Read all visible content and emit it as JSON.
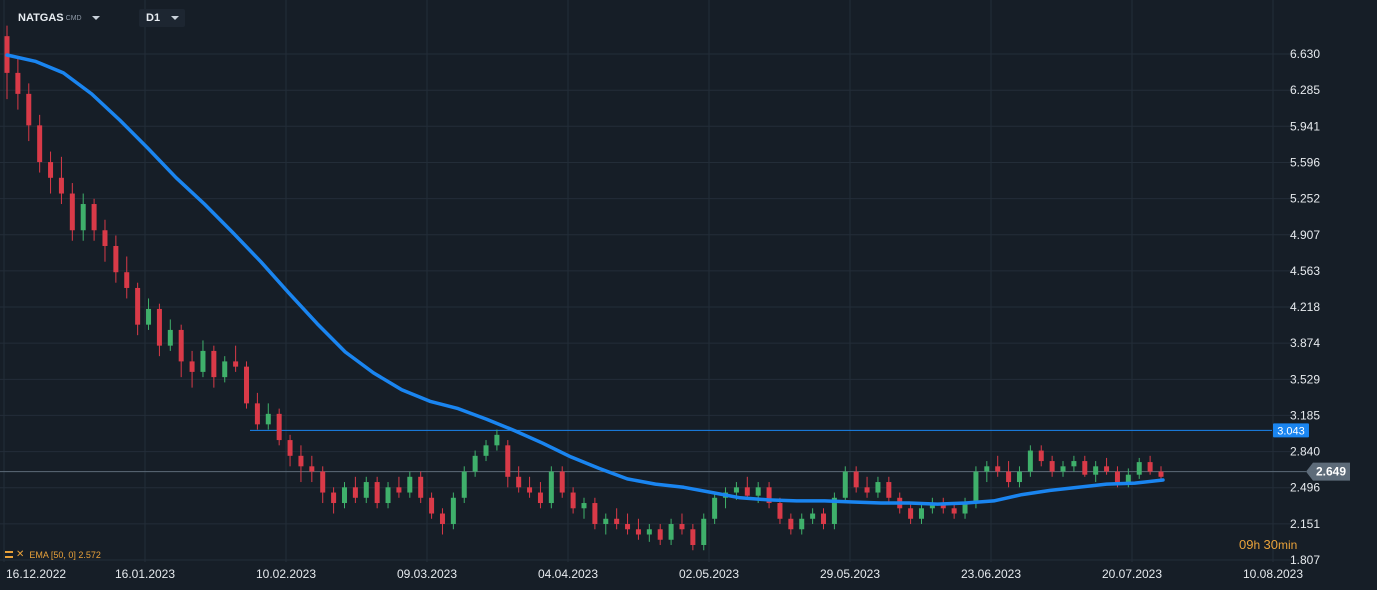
{
  "header": {
    "symbol": "NATGAS",
    "symbol_sub": "CMD",
    "timeframe": "D1"
  },
  "indicator": {
    "label": "EMA [50, 0] 2.572"
  },
  "countdown": {
    "h": "09",
    "h_unit": "h ",
    "m": "30",
    "m_unit": "min"
  },
  "colors": {
    "background": "#161e27",
    "grid": "#232d38",
    "up": "#3fb06b",
    "down": "#d93a48",
    "ema": "#1a85f0",
    "level_line": "#1a85f0",
    "price_tag": "#5d6b79",
    "axis_text": "#e6eaee"
  },
  "chart_data": {
    "type": "candlestick",
    "y_ticks": [
      "6.630",
      "6.285",
      "5.941",
      "5.596",
      "5.252",
      "4.907",
      "4.563",
      "4.218",
      "3.874",
      "3.529",
      "3.185",
      "2.840",
      "2.496",
      "2.151",
      "1.807"
    ],
    "ylim": [
      1.807,
      6.63
    ],
    "x_ticks": [
      "16.12.2022",
      "16.01.2023",
      "10.02.2023",
      "09.03.2023",
      "04.04.2023",
      "02.05.2023",
      "29.05.2023",
      "23.06.2023",
      "20.07.2023",
      "10.08.2023"
    ],
    "horizontal_level": 3.043,
    "horizontal_level_label": "3.043",
    "last_price": 2.649,
    "last_price_label": "2.649",
    "ema": {
      "name": "EMA [50, 0]",
      "value": 2.572,
      "values": [
        6.62,
        6.56,
        6.45,
        6.25,
        6.0,
        5.73,
        5.45,
        5.2,
        4.93,
        4.65,
        4.35,
        4.06,
        3.79,
        3.59,
        3.43,
        3.32,
        3.25,
        3.15,
        3.04,
        2.92,
        2.79,
        2.68,
        2.58,
        2.53,
        2.5,
        2.45,
        2.4,
        2.38,
        2.37,
        2.37,
        2.36,
        2.35,
        2.35,
        2.34,
        2.35,
        2.37,
        2.43,
        2.47,
        2.5,
        2.53,
        2.54,
        2.57
      ]
    },
    "ohlc": [
      [
        6.8,
        6.9,
        6.2,
        6.45
      ],
      [
        6.45,
        6.6,
        6.1,
        6.25
      ],
      [
        6.25,
        6.35,
        5.8,
        5.95
      ],
      [
        5.95,
        6.05,
        5.5,
        5.6
      ],
      [
        5.6,
        5.7,
        5.3,
        5.45
      ],
      [
        5.45,
        5.65,
        5.2,
        5.3
      ],
      [
        5.3,
        5.4,
        4.85,
        4.95
      ],
      [
        4.95,
        5.3,
        4.85,
        5.2
      ],
      [
        5.2,
        5.25,
        4.85,
        4.95
      ],
      [
        4.95,
        5.05,
        4.65,
        4.8
      ],
      [
        4.8,
        4.9,
        4.45,
        4.55
      ],
      [
        4.55,
        4.7,
        4.3,
        4.4
      ],
      [
        4.4,
        4.45,
        3.95,
        4.05
      ],
      [
        4.05,
        4.3,
        4.0,
        4.2
      ],
      [
        4.2,
        4.25,
        3.75,
        3.85
      ],
      [
        3.85,
        4.1,
        3.8,
        4.0
      ],
      [
        4.0,
        4.05,
        3.55,
        3.7
      ],
      [
        3.7,
        3.8,
        3.45,
        3.6
      ],
      [
        3.6,
        3.9,
        3.55,
        3.8
      ],
      [
        3.8,
        3.85,
        3.45,
        3.55
      ],
      [
        3.55,
        3.75,
        3.5,
        3.7
      ],
      [
        3.7,
        3.85,
        3.6,
        3.65
      ],
      [
        3.65,
        3.7,
        3.25,
        3.3
      ],
      [
        3.3,
        3.4,
        3.05,
        3.1
      ],
      [
        3.1,
        3.3,
        3.05,
        3.2
      ],
      [
        3.2,
        3.25,
        2.9,
        2.95
      ],
      [
        2.95,
        3.0,
        2.7,
        2.8
      ],
      [
        2.8,
        2.9,
        2.55,
        2.7
      ],
      [
        2.7,
        2.8,
        2.55,
        2.65
      ],
      [
        2.65,
        2.7,
        2.35,
        2.45
      ],
      [
        2.45,
        2.5,
        2.25,
        2.35
      ],
      [
        2.35,
        2.55,
        2.3,
        2.5
      ],
      [
        2.5,
        2.6,
        2.35,
        2.4
      ],
      [
        2.4,
        2.6,
        2.35,
        2.55
      ],
      [
        2.55,
        2.6,
        2.3,
        2.35
      ],
      [
        2.35,
        2.55,
        2.3,
        2.5
      ],
      [
        2.5,
        2.6,
        2.4,
        2.45
      ],
      [
        2.45,
        2.65,
        2.4,
        2.6
      ],
      [
        2.6,
        2.65,
        2.35,
        2.4
      ],
      [
        2.4,
        2.45,
        2.2,
        2.25
      ],
      [
        2.25,
        2.3,
        2.05,
        2.15
      ],
      [
        2.15,
        2.45,
        2.1,
        2.4
      ],
      [
        2.4,
        2.7,
        2.35,
        2.65
      ],
      [
        2.65,
        2.85,
        2.6,
        2.8
      ],
      [
        2.8,
        2.95,
        2.75,
        2.9
      ],
      [
        2.9,
        3.05,
        2.85,
        3.0
      ],
      [
        2.9,
        2.95,
        2.5,
        2.6
      ],
      [
        2.6,
        2.7,
        2.45,
        2.5
      ],
      [
        2.5,
        2.6,
        2.4,
        2.45
      ],
      [
        2.45,
        2.55,
        2.3,
        2.35
      ],
      [
        2.35,
        2.7,
        2.3,
        2.65
      ],
      [
        2.65,
        2.7,
        2.4,
        2.45
      ],
      [
        2.45,
        2.5,
        2.25,
        2.3
      ],
      [
        2.3,
        2.4,
        2.2,
        2.35
      ],
      [
        2.35,
        2.4,
        2.1,
        2.15
      ],
      [
        2.15,
        2.25,
        2.05,
        2.2
      ],
      [
        2.2,
        2.3,
        2.1,
        2.15
      ],
      [
        2.15,
        2.25,
        2.05,
        2.1
      ],
      [
        2.1,
        2.2,
        2.0,
        2.05
      ],
      [
        2.05,
        2.15,
        1.98,
        2.1
      ],
      [
        2.1,
        2.15,
        1.95,
        2.0
      ],
      [
        2.0,
        2.2,
        1.95,
        2.15
      ],
      [
        2.15,
        2.25,
        2.05,
        2.1
      ],
      [
        2.1,
        2.15,
        1.9,
        1.95
      ],
      [
        1.95,
        2.25,
        1.9,
        2.2
      ],
      [
        2.2,
        2.45,
        2.15,
        2.4
      ],
      [
        2.4,
        2.5,
        2.3,
        2.45
      ],
      [
        2.45,
        2.55,
        2.38,
        2.5
      ],
      [
        2.5,
        2.6,
        2.4,
        2.42
      ],
      [
        2.42,
        2.55,
        2.35,
        2.5
      ],
      [
        2.5,
        2.55,
        2.3,
        2.35
      ],
      [
        2.35,
        2.4,
        2.15,
        2.2
      ],
      [
        2.2,
        2.25,
        2.05,
        2.1
      ],
      [
        2.1,
        2.25,
        2.05,
        2.2
      ],
      [
        2.2,
        2.3,
        2.15,
        2.25
      ],
      [
        2.25,
        2.3,
        2.1,
        2.15
      ],
      [
        2.15,
        2.45,
        2.1,
        2.4
      ],
      [
        2.4,
        2.7,
        2.35,
        2.65
      ],
      [
        2.65,
        2.7,
        2.45,
        2.5
      ],
      [
        2.5,
        2.6,
        2.4,
        2.45
      ],
      [
        2.45,
        2.6,
        2.4,
        2.55
      ],
      [
        2.55,
        2.6,
        2.35,
        2.4
      ],
      [
        2.4,
        2.45,
        2.25,
        2.3
      ],
      [
        2.3,
        2.35,
        2.15,
        2.2
      ],
      [
        2.2,
        2.35,
        2.15,
        2.3
      ],
      [
        2.3,
        2.4,
        2.25,
        2.35
      ],
      [
        2.35,
        2.4,
        2.25,
        2.3
      ],
      [
        2.3,
        2.35,
        2.2,
        2.25
      ],
      [
        2.25,
        2.4,
        2.2,
        2.35
      ],
      [
        2.35,
        2.7,
        2.3,
        2.65
      ],
      [
        2.65,
        2.75,
        2.55,
        2.7
      ],
      [
        2.7,
        2.8,
        2.6,
        2.65
      ],
      [
        2.65,
        2.75,
        2.5,
        2.55
      ],
      [
        2.55,
        2.7,
        2.5,
        2.65
      ],
      [
        2.65,
        2.9,
        2.6,
        2.85
      ],
      [
        2.85,
        2.9,
        2.7,
        2.75
      ],
      [
        2.75,
        2.8,
        2.6,
        2.65
      ],
      [
        2.65,
        2.75,
        2.6,
        2.7
      ],
      [
        2.7,
        2.8,
        2.65,
        2.75
      ],
      [
        2.75,
        2.8,
        2.6,
        2.62
      ],
      [
        2.62,
        2.75,
        2.55,
        2.7
      ],
      [
        2.7,
        2.78,
        2.62,
        2.65
      ],
      [
        2.65,
        2.7,
        2.5,
        2.55
      ],
      [
        2.55,
        2.68,
        2.5,
        2.62
      ],
      [
        2.62,
        2.78,
        2.58,
        2.74
      ],
      [
        2.74,
        2.8,
        2.62,
        2.65
      ],
      [
        2.65,
        2.7,
        2.55,
        2.6
      ]
    ]
  }
}
